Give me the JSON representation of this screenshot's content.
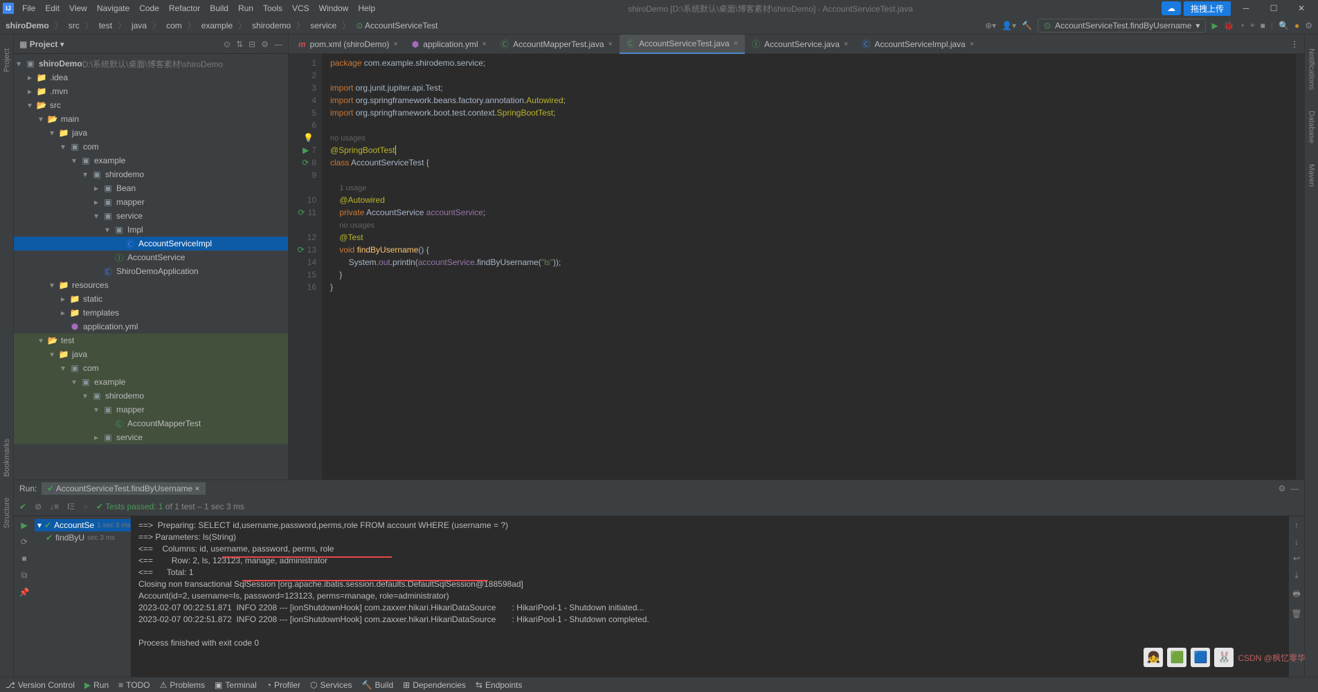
{
  "title": {
    "project": "shiroDemo",
    "path": "[D:\\系统默认\\桌面\\博客素材\\shiroDemo]",
    "file": "AccountServiceTest.java"
  },
  "menu": {
    "file": "File",
    "edit": "Edit",
    "view": "View",
    "navigate": "Navigate",
    "code": "Code",
    "refactor": "Refactor",
    "build": "Build",
    "run": "Run",
    "tools": "Tools",
    "vcs": "VCS",
    "window": "Window",
    "help": "Help"
  },
  "titlebar_buttons": {
    "upload": "拖拽上传"
  },
  "breadcrumbs": [
    "shiroDemo",
    "src",
    "test",
    "java",
    "com",
    "example",
    "shirodemo",
    "service",
    "AccountServiceTest"
  ],
  "run_config": "AccountServiceTest.findByUsername",
  "project_pane": {
    "title": "Project",
    "root": {
      "name": "shiroDemo",
      "path": "D:\\系统默认\\桌面\\博客素材\\shiroDemo"
    },
    "tree": [
      {
        "d": 1,
        "t": "folder-closed",
        "n": ".idea"
      },
      {
        "d": 1,
        "t": "folder-closed",
        "n": ".mvn"
      },
      {
        "d": 1,
        "t": "folder-open",
        "n": "src"
      },
      {
        "d": 2,
        "t": "folder-open",
        "n": "main"
      },
      {
        "d": 3,
        "t": "java-open",
        "n": "java"
      },
      {
        "d": 4,
        "t": "pkg-open",
        "n": "com"
      },
      {
        "d": 5,
        "t": "pkg-open",
        "n": "example"
      },
      {
        "d": 6,
        "t": "pkg-open",
        "n": "shirodemo"
      },
      {
        "d": 7,
        "t": "pkg-closed",
        "n": "Bean"
      },
      {
        "d": 7,
        "t": "pkg-closed",
        "n": "mapper"
      },
      {
        "d": 7,
        "t": "pkg-open",
        "n": "service"
      },
      {
        "d": 8,
        "t": "pkg-open",
        "n": "Impl"
      },
      {
        "d": 9,
        "t": "class",
        "n": "AccountServiceImpl",
        "sel": true
      },
      {
        "d": 8,
        "t": "interface",
        "n": "AccountService"
      },
      {
        "d": 7,
        "t": "class",
        "n": "ShiroDemoApplication"
      },
      {
        "d": 3,
        "t": "res-open",
        "n": "resources"
      },
      {
        "d": 4,
        "t": "folder-closed",
        "n": "static"
      },
      {
        "d": 4,
        "t": "folder-closed",
        "n": "templates"
      },
      {
        "d": 4,
        "t": "yml",
        "n": "application.yml"
      },
      {
        "d": 2,
        "t": "folder-open",
        "n": "test",
        "test": true
      },
      {
        "d": 3,
        "t": "java-open",
        "n": "java",
        "test": true
      },
      {
        "d": 4,
        "t": "pkg-open",
        "n": "com",
        "test": true
      },
      {
        "d": 5,
        "t": "pkg-open",
        "n": "example",
        "test": true
      },
      {
        "d": 6,
        "t": "pkg-open",
        "n": "shirodemo",
        "test": true
      },
      {
        "d": 7,
        "t": "pkg-open",
        "n": "mapper",
        "test": true
      },
      {
        "d": 8,
        "t": "test",
        "n": "AccountMapperTest",
        "test": true
      },
      {
        "d": 7,
        "t": "pkg-closed",
        "n": "service",
        "test": true
      }
    ]
  },
  "tabs": [
    {
      "i": "m",
      "n": "pom.xml (shiroDemo)"
    },
    {
      "i": "yml",
      "n": "application.yml"
    },
    {
      "i": "test",
      "n": "AccountMapperTest.java"
    },
    {
      "i": "test",
      "n": "AccountServiceTest.java",
      "active": true
    },
    {
      "i": "int",
      "n": "AccountService.java"
    },
    {
      "i": "class",
      "n": "AccountServiceImpl.java"
    }
  ],
  "code": {
    "lines": [
      {
        "n": 1,
        "h": "<span class='kw'>package</span> com.example.shirodemo.service;"
      },
      {
        "n": 2,
        "h": ""
      },
      {
        "n": 3,
        "h": "<span class='kw'>import</span> org.junit.jupiter.api.Test;"
      },
      {
        "n": 4,
        "h": "<span class='kw'>import</span> org.springframework.beans.factory.annotation.<span class='annot'>Autowired</span>;"
      },
      {
        "n": 5,
        "h": "<span class='kw'>import</span> org.springframework.boot.test.context.<span class='annot'>SpringBootTest</span>;"
      },
      {
        "n": 6,
        "h": ""
      },
      {
        "n": "",
        "h": "<span class='hint'>no usages</span>",
        "bulb": true
      },
      {
        "n": 7,
        "h": "<span class='annot'>@SpringBootTest</span><span class='cursor'></span>",
        "run": true
      },
      {
        "n": 8,
        "h": "<span class='kw'>class</span> AccountServiceTest {",
        "run": "t"
      },
      {
        "n": 9,
        "h": ""
      },
      {
        "n": "",
        "h": "    <span class='hint'>1 usage</span>"
      },
      {
        "n": 10,
        "h": "    <span class='annot'>@Autowired</span>"
      },
      {
        "n": 11,
        "h": "    <span class='kw'>private</span> AccountService <span class='field'>accountService</span>;",
        "run": "t"
      },
      {
        "n": "",
        "h": "    <span class='hint'>no usages</span>"
      },
      {
        "n": 12,
        "h": "    <span class='annot'>@Test</span>"
      },
      {
        "n": 13,
        "h": "    <span class='kw'>void</span> <span class='method'>findByUsername</span>() {",
        "run": "t"
      },
      {
        "n": 14,
        "h": "        System.<span class='field'>out</span>.println(<span class='field'>accountService</span>.findByUsername(<span class='str'>\"ls\"</span>));"
      },
      {
        "n": 15,
        "h": "    }"
      },
      {
        "n": 16,
        "h": "}"
      }
    ]
  },
  "run_panel": {
    "title": "Run:",
    "tab": "AccountServiceTest.findByUsername",
    "status_prefix": "Tests passed:",
    "status_count": "1",
    "status_suffix": "of 1 test – 1 sec 3 ms",
    "tests": [
      {
        "n": "AccountSe",
        "t": "1 sec 3 ms",
        "sel": true
      },
      {
        "n": "findByU",
        "t": "sec 3 ms"
      }
    ],
    "console": [
      "==>  Preparing: SELECT id,username,password,perms,role FROM account WHERE (username = ?)",
      "==> Parameters: ls(String)",
      "<==    Columns: id, username, password, perms, role",
      "<==        Row: 2, ls, 123123, manage, administrator",
      "<==      Total: 1",
      "Closing non transactional SqlSession [org.apache.ibatis.session.defaults.DefaultSqlSession@188598ad]",
      "Account(id=2, username=ls, password=123123, perms=manage, role=administrator)",
      "2023-02-07 00:22:51.871  INFO 2208 --- [ionShutdownHook] com.zaxxer.hikari.HikariDataSource       : HikariPool-1 - Shutdown initiated...",
      "2023-02-07 00:22:51.872  INFO 2208 --- [ionShutdownHook] com.zaxxer.hikari.HikariDataSource       : HikariPool-1 - Shutdown completed.",
      "",
      "Process finished with exit code 0"
    ]
  },
  "statusbar": {
    "items": [
      "Version Control",
      "Run",
      "TODO",
      "Problems",
      "Terminal",
      "Profiler",
      "Services",
      "Build",
      "Dependencies",
      "Endpoints"
    ]
  },
  "watermark": "CSDN @枫忆零华",
  "right_tabs": [
    "Notifications",
    "Database",
    "Maven"
  ],
  "left_tabs": [
    "Project",
    "Bookmarks",
    "Structure"
  ]
}
